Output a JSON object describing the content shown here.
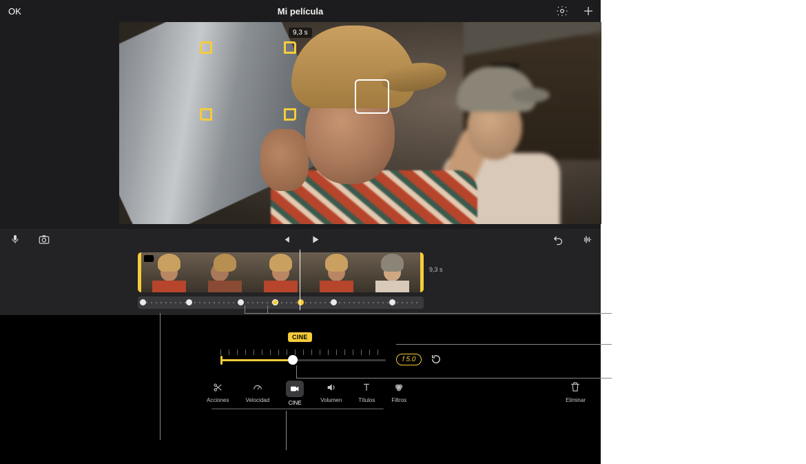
{
  "header": {
    "ok_label": "OK",
    "title": "Mi película",
    "icons": {
      "settings": "gear-icon",
      "add": "plus-icon"
    }
  },
  "viewer": {
    "duration_badge": "9,3 s",
    "primary_focus": "primary-subject",
    "secondary_focus": "secondary-subject"
  },
  "transport": {
    "icons": {
      "mic": "microphone-icon",
      "camera": "camera-icon",
      "prev": "skip-start-icon",
      "play": "play-icon",
      "undo": "undo-icon",
      "audio": "waveform-icon"
    }
  },
  "timeline": {
    "clip_duration": "9,3 s",
    "thumbs": 5,
    "focus_points": [
      {
        "pos": 3,
        "kind": "white"
      },
      {
        "pos": 70,
        "kind": "white"
      },
      {
        "pos": 145,
        "kind": "white"
      },
      {
        "pos": 195,
        "kind": "gold"
      },
      {
        "pos": 232,
        "kind": "gold-mid"
      },
      {
        "pos": 280,
        "kind": "white"
      },
      {
        "pos": 365,
        "kind": "white"
      }
    ]
  },
  "cinematic": {
    "badge": "CINE",
    "fstop": "f 5.0",
    "slider_value": 0.44
  },
  "tools": {
    "items": [
      {
        "id": "acciones",
        "label": "Acciones",
        "icon": "scissors-icon",
        "active": false
      },
      {
        "id": "velocidad",
        "label": "Velocidad",
        "icon": "speedometer-icon",
        "active": false
      },
      {
        "id": "cine",
        "label": "CINE",
        "icon": "video-camera-icon",
        "active": true
      },
      {
        "id": "volumen",
        "label": "Volumen",
        "icon": "speaker-icon",
        "active": false
      },
      {
        "id": "titulos",
        "label": "Títulos",
        "icon": "text-icon",
        "active": false
      },
      {
        "id": "filtros",
        "label": "Filtros",
        "icon": "filters-icon",
        "active": false
      }
    ],
    "delete_label": "Eliminar",
    "delete_icon": "trash-icon"
  }
}
